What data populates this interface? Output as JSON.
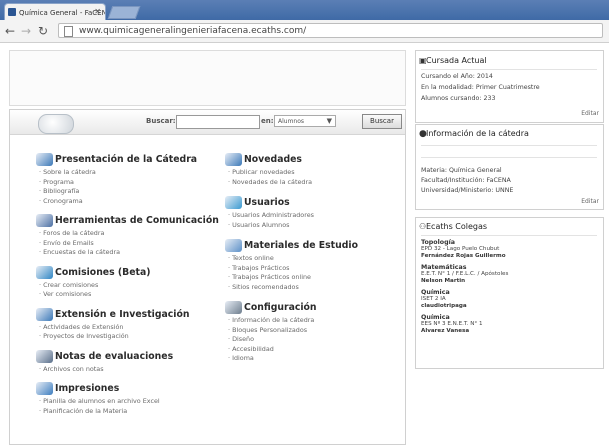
{
  "browser": {
    "tab_title": "Química General - FaCENA",
    "url": "www.quimicageneralingenieriafacena.ecaths.com/"
  },
  "search": {
    "label": "Buscar:",
    "in_label": "en:",
    "select_value": "Alumnos",
    "button": "Buscar"
  },
  "left_sections": [
    {
      "title": "Presentación de la Cátedra",
      "icon": "airplane-icon",
      "items": [
        "Sobre la cátedra",
        "Programa",
        "Bibliografía",
        "Cronograma"
      ]
    },
    {
      "title": "Herramientas de Comunicación",
      "icon": "people-icon",
      "items": [
        "Foros de la cátedra",
        "Envío de Emails",
        "Encuestas de la cátedra"
      ]
    },
    {
      "title": "Comisiones (Beta)",
      "icon": "group-icon",
      "items": [
        "Crear comisiones",
        "Ver comisiones"
      ]
    },
    {
      "title": "Extensión e Investigación",
      "icon": "airplane-icon",
      "items": [
        "Actividades de Extensión",
        "Proyectos de Investigación"
      ]
    },
    {
      "title": "Notas de evaluaciones",
      "icon": "pencil-icon",
      "items": [
        "Archivos con notas"
      ]
    },
    {
      "title": "Impresiones",
      "icon": "globe-icon",
      "items": [
        "Planilla de alumnos en archivo Excel",
        "Planificación de la Materia"
      ]
    }
  ],
  "right_sections": [
    {
      "title": "Novedades",
      "icon": "airplane-icon",
      "items": [
        "Publicar novedades",
        "Novedades de la cátedra"
      ]
    },
    {
      "title": "Usuarios",
      "icon": "users-icon",
      "items": [
        "Usuarios Administradores",
        "Usuarios Alumnos"
      ]
    },
    {
      "title": "Materiales de Estudio",
      "icon": "book-icon",
      "items": [
        "Textos online",
        "Trabajos Prácticos",
        "Trabajos Prácticos online",
        "Sitios recomendados"
      ]
    },
    {
      "title": "Configuración",
      "icon": "gears-icon",
      "items": [
        "Información de la cátedra",
        "Bloques Personalizados",
        "Diseño",
        "Accesibilidad",
        "Idioma"
      ]
    }
  ],
  "cursada": {
    "title": "Cursada Actual",
    "lines": [
      "Cursando el Año: 2014",
      "En la modalidad: Primer Cuatrimestre",
      "Alumnos cursando: 233"
    ],
    "edit": "Editar"
  },
  "info": {
    "title": "Información de la cátedra",
    "lines": [
      "Materia: Química General",
      "Facultad/Institución: FaCENA",
      "Universidad/Ministerio: UNNE"
    ],
    "edit": "Editar"
  },
  "colegas": {
    "title": "Ecaths Colegas",
    "groups": [
      {
        "name": "Topología",
        "lines": [
          "EPD 32 - Lago Puelo Chubut",
          "Fernández Rojas Guillermo"
        ]
      },
      {
        "name": "Matemáticas",
        "lines": [
          "E.E.T. N° 1 / F.E.L.C. / Apóstoles",
          "Nelson Martin"
        ]
      },
      {
        "name": "Química",
        "lines": [
          "ISET 2 IA",
          "claudiotripaga"
        ]
      },
      {
        "name": "Química",
        "lines": [
          "EES Nº 3 E.N.E.T. N° 1",
          "Alvarez Vanesa"
        ]
      }
    ]
  },
  "colors": {
    "accent": "#2a5592",
    "tabbar": "#4a72ad"
  }
}
